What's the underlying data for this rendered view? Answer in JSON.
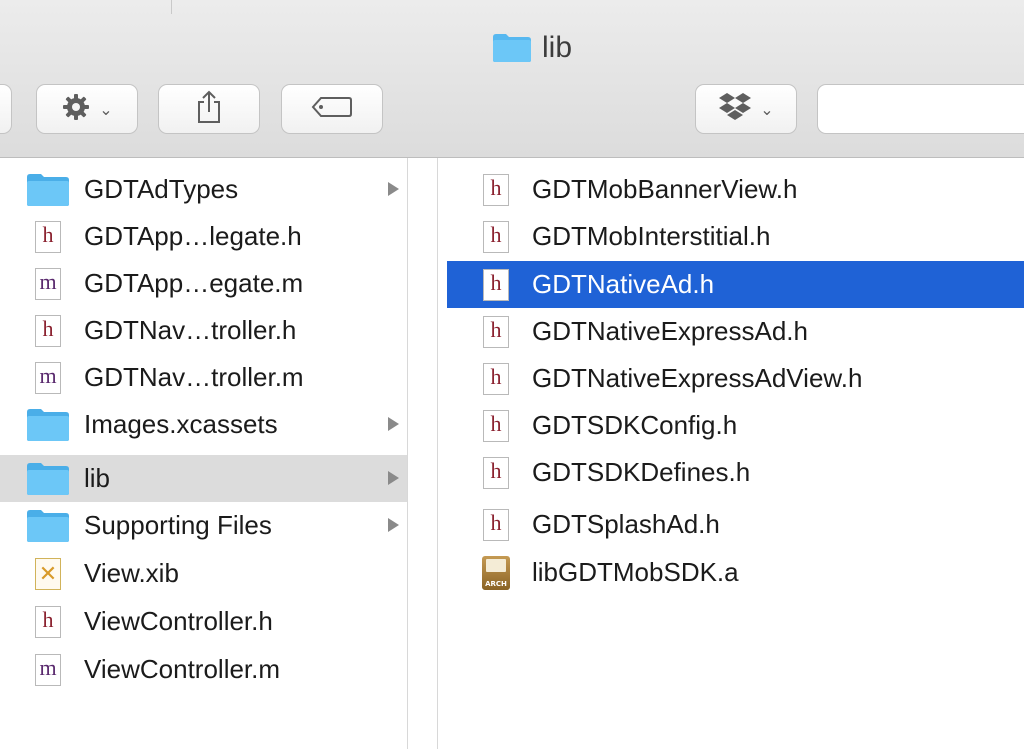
{
  "window": {
    "title": "lib"
  },
  "toolbar": {
    "action_icon": "gear-icon",
    "share_icon": "share-icon",
    "tag_icon": "tag-icon",
    "dropbox_icon": "dropbox-icon",
    "chevron": "⌄"
  },
  "left_column": {
    "items": [
      {
        "name": "GDTAdTypes",
        "kind": "folder",
        "has_children": true
      },
      {
        "name": "GDTApp…legate.h",
        "kind": "h"
      },
      {
        "name": "GDTApp…egate.m",
        "kind": "m"
      },
      {
        "name": "GDTNav…troller.h",
        "kind": "h"
      },
      {
        "name": "GDTNav…troller.m",
        "kind": "m"
      },
      {
        "name": "Images.xcassets",
        "kind": "folder",
        "has_children": true
      },
      {
        "name": "lib",
        "kind": "folder",
        "has_children": true,
        "selected": true
      },
      {
        "name": "Supporting Files",
        "kind": "folder",
        "has_children": true
      },
      {
        "name": "View.xib",
        "kind": "xib"
      },
      {
        "name": "ViewController.h",
        "kind": "h"
      },
      {
        "name": "ViewController.m",
        "kind": "m"
      }
    ]
  },
  "right_column": {
    "items": [
      {
        "name": "GDTMobBannerView.h",
        "kind": "h"
      },
      {
        "name": "GDTMobInterstitial.h",
        "kind": "h"
      },
      {
        "name": "GDTNativeAd.h",
        "kind": "h",
        "selected": true
      },
      {
        "name": "GDTNativeExpressAd.h",
        "kind": "h"
      },
      {
        "name": "GDTNativeExpressAdView.h",
        "kind": "h"
      },
      {
        "name": "GDTSDKConfig.h",
        "kind": "h"
      },
      {
        "name": "GDTSDKDefines.h",
        "kind": "h"
      },
      {
        "name": "GDTSplashAd.h",
        "kind": "h"
      },
      {
        "name": "libGDTMobSDK.a",
        "kind": "archive"
      }
    ]
  },
  "icon_letters": {
    "h": "h",
    "m": "m",
    "xib": "✕",
    "archive": "ARCH"
  },
  "colors": {
    "folder": "#57b8f0",
    "selection_active": "#1f62d6",
    "selection_inactive": "#dcdcdc"
  }
}
